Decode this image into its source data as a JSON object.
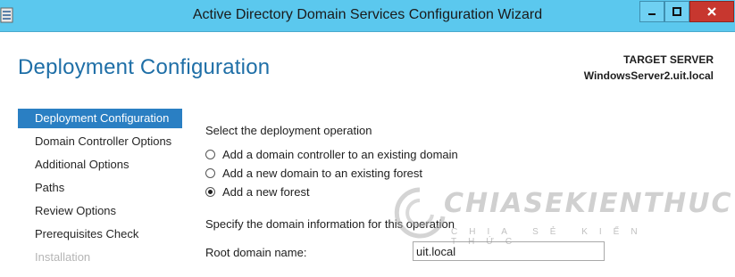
{
  "window": {
    "title": "Active Directory Domain Services Configuration Wizard",
    "icon": "server-icon",
    "controls": {
      "minimize": "minimize-icon",
      "maximize": "maximize-icon",
      "close": "close-icon"
    }
  },
  "header": {
    "page_title": "Deployment Configuration",
    "target_label": "TARGET SERVER",
    "target_value": "WindowsServer2.uit.local"
  },
  "nav": {
    "items": [
      {
        "label": "Deployment Configuration",
        "state": "active"
      },
      {
        "label": "Domain Controller Options",
        "state": "normal"
      },
      {
        "label": "Additional Options",
        "state": "normal"
      },
      {
        "label": "Paths",
        "state": "normal"
      },
      {
        "label": "Review Options",
        "state": "normal"
      },
      {
        "label": "Prerequisites Check",
        "state": "normal"
      },
      {
        "label": "Installation",
        "state": "disabled"
      }
    ]
  },
  "main": {
    "operation_label": "Select the deployment operation",
    "options": [
      {
        "label": "Add a domain controller to an existing domain",
        "checked": false
      },
      {
        "label": "Add a new domain to an existing forest",
        "checked": false
      },
      {
        "label": "Add a new forest",
        "checked": true
      }
    ],
    "domain_info_label": "Specify the domain information for this operation",
    "root_domain_label": "Root domain name:",
    "root_domain_value": "uit.local"
  },
  "watermark": {
    "main": "CHIASEKIENTHUC",
    "sub": "CHIA SẺ KIẾN THỨC"
  },
  "colors": {
    "titlebar": "#5bc8ee",
    "accent": "#2a7fc3",
    "title_text": "#1f6fa7",
    "close_button": "#c7372f"
  }
}
